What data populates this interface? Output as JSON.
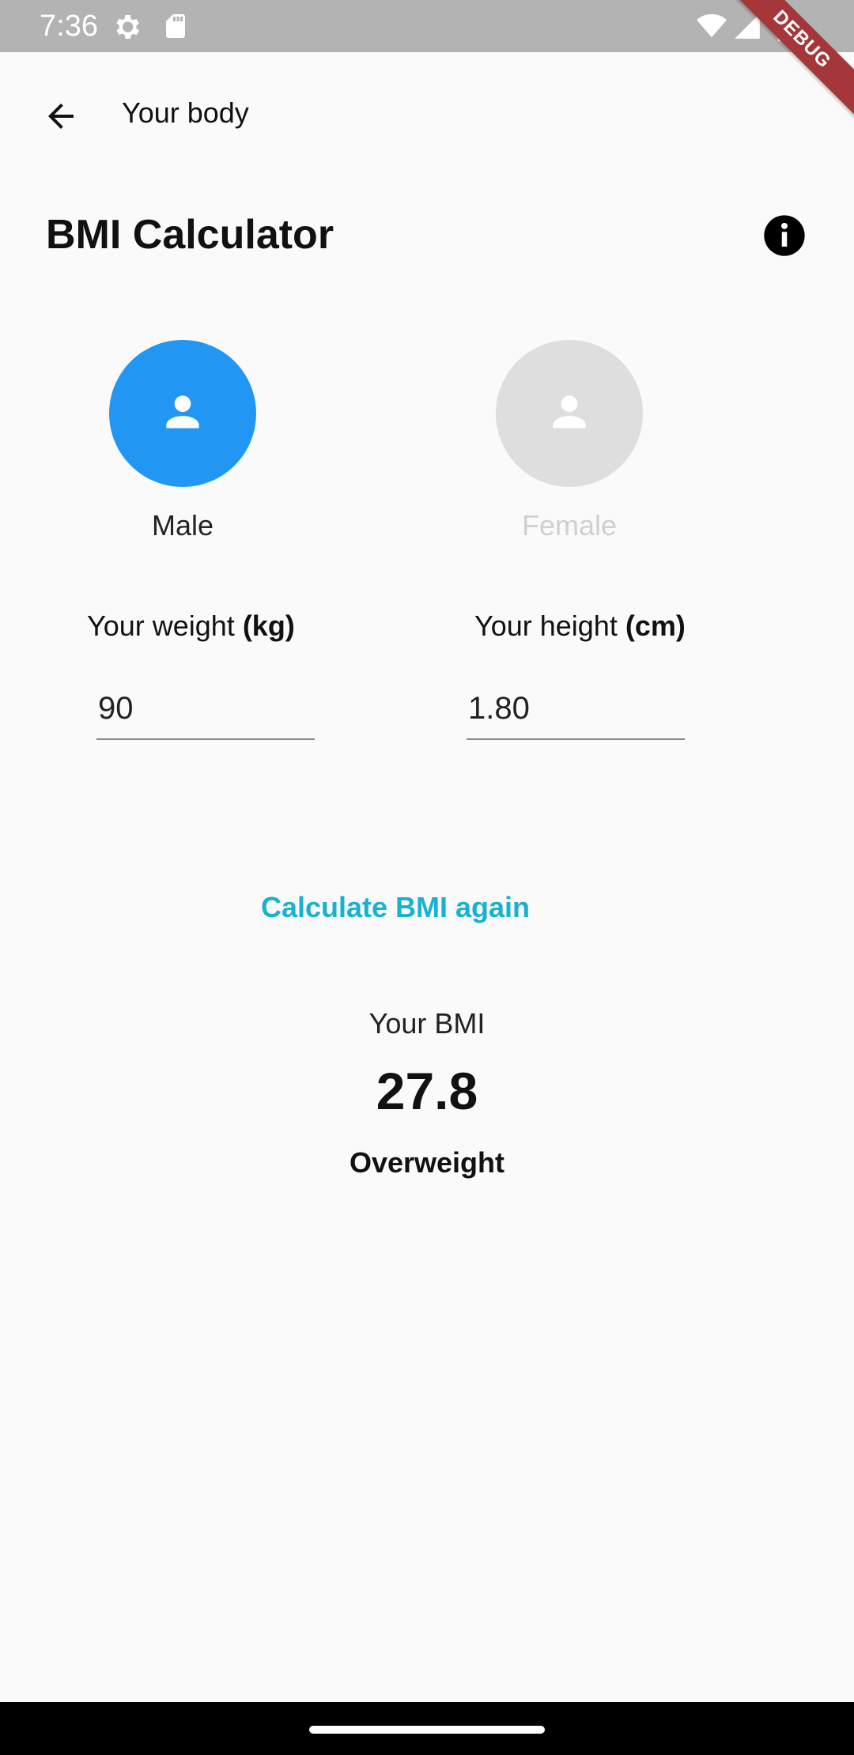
{
  "status_bar": {
    "time": "7:36",
    "icons": [
      "settings-icon",
      "sd-card-icon",
      "wifi-icon",
      "signal-icon",
      "battery-icon"
    ]
  },
  "debug_banner": "DEBUG",
  "app_bar": {
    "back_icon": "arrow-back-icon",
    "title": "Your body"
  },
  "page": {
    "title": "BMI Calculator",
    "info_icon": "info-icon"
  },
  "gender": {
    "male": {
      "label": "Male",
      "selected": true
    },
    "female": {
      "label": "Female",
      "selected": false
    }
  },
  "weight": {
    "label_prefix": "Your weight ",
    "label_unit": "(kg)",
    "value": "90"
  },
  "height": {
    "label_prefix": "Your height ",
    "label_unit": "(cm)",
    "value": "1.80"
  },
  "calculate_button": "Calculate BMI again",
  "result": {
    "label": "Your BMI",
    "value": "27.8",
    "category": "Overweight"
  },
  "colors": {
    "accent_blue": "#2196f3",
    "button_teal": "#17b2cf",
    "inactive_gray": "#dedede",
    "status_bar": "#b3b3b3",
    "debug_red": "#a5363a"
  }
}
